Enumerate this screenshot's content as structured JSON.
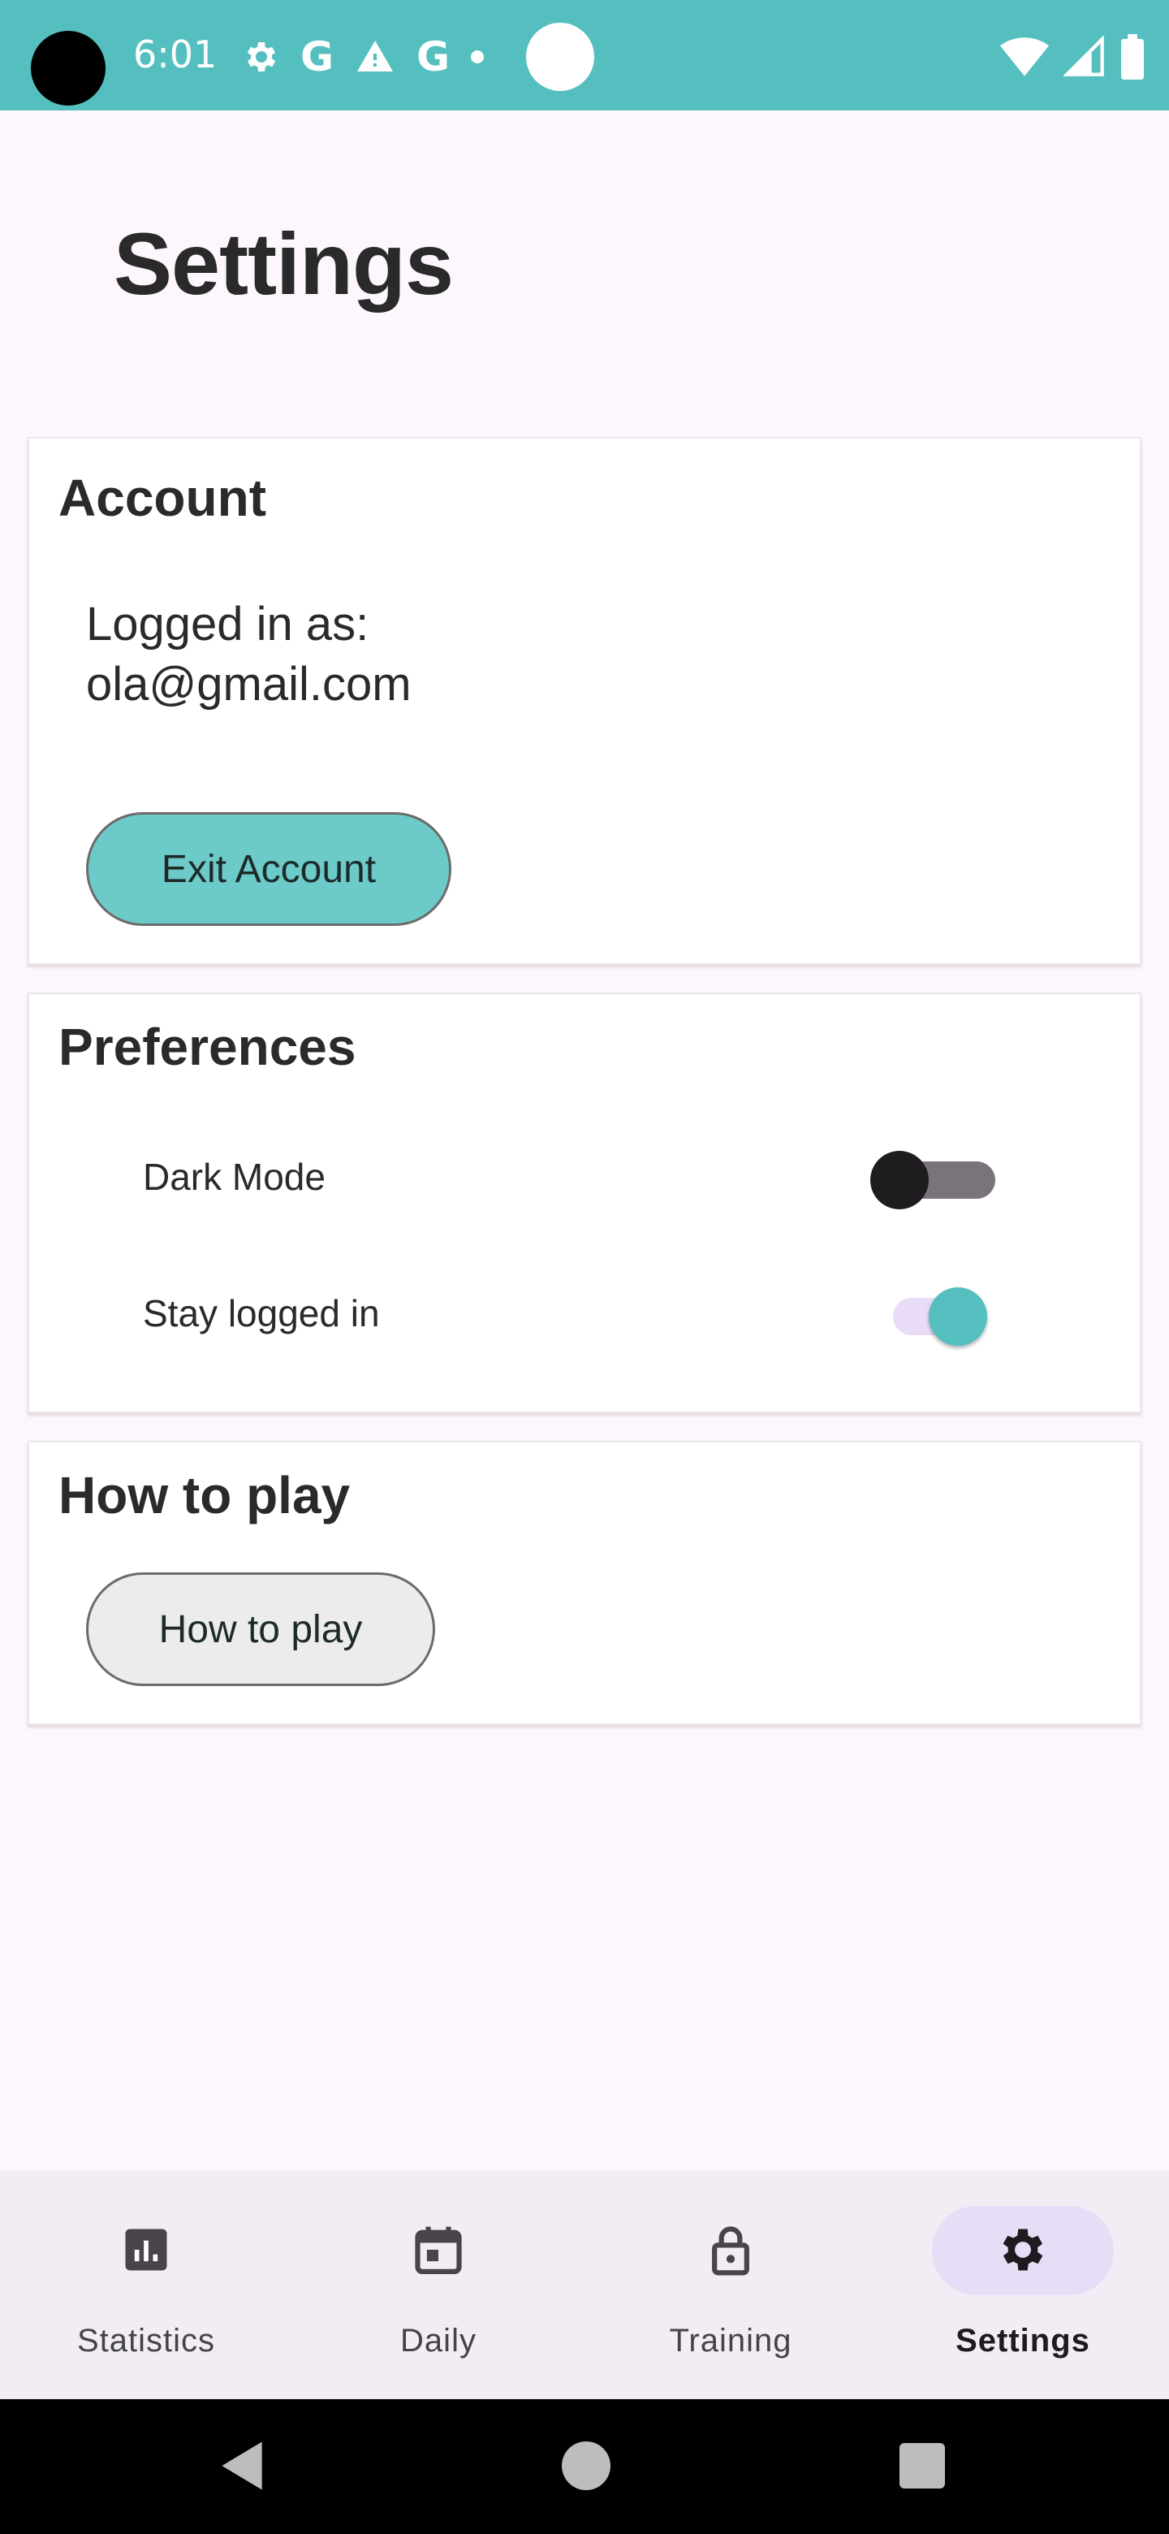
{
  "status_bar": {
    "time": "6:01",
    "icons": [
      "gear-icon",
      "google-icon",
      "warning-icon",
      "google-icon",
      "dot-icon",
      "circle-icon"
    ],
    "right_icons": [
      "wifi-icon",
      "signal-icon",
      "battery-icon"
    ],
    "background": "#55bfbf"
  },
  "page": {
    "title": "Settings"
  },
  "account": {
    "title": "Account",
    "logged_in_label": "Logged in as:",
    "email": "ola@gmail.com",
    "exit_button": "Exit Account",
    "button_color": "#6ccbc8"
  },
  "preferences": {
    "title": "Preferences",
    "items": [
      {
        "label": "Dark Mode",
        "enabled": false
      },
      {
        "label": "Stay logged in",
        "enabled": true
      }
    ],
    "accent": "#55bfbf"
  },
  "how_to_play": {
    "title": "How to play",
    "button": "How to play"
  },
  "bottom_nav": {
    "items": [
      {
        "label": "Statistics",
        "icon": "bar-chart-icon",
        "active": false
      },
      {
        "label": "Daily",
        "icon": "calendar-icon",
        "active": false
      },
      {
        "label": "Training",
        "icon": "lock-icon",
        "active": false
      },
      {
        "label": "Settings",
        "icon": "gear-icon",
        "active": true
      }
    ],
    "indicator_color": "#e8ddf6"
  },
  "system_nav": {
    "buttons": [
      "back-icon",
      "home-icon",
      "recents-icon"
    ]
  }
}
